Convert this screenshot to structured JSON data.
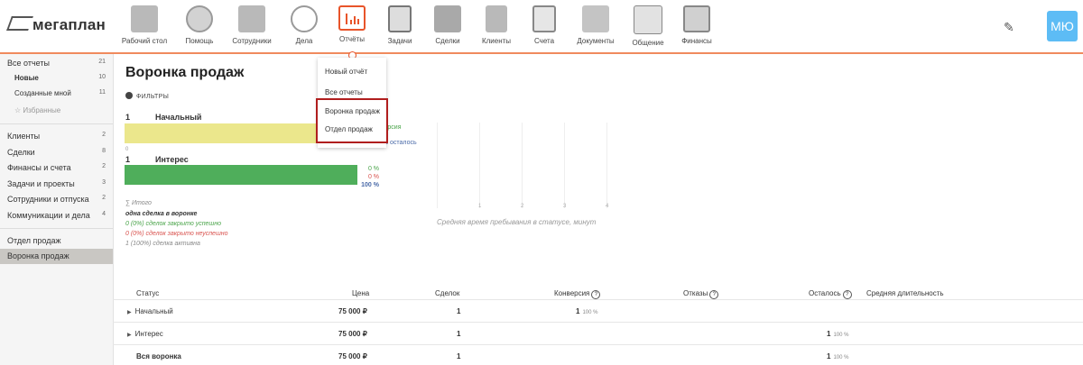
{
  "app": {
    "logo": "мегаплан",
    "avatar_initials": "МЮ"
  },
  "nav": [
    {
      "label": "Рабочий стол",
      "icon": "desktop-icon"
    },
    {
      "label": "Помощь",
      "icon": "lifebuoy-icon"
    },
    {
      "label": "Сотрудники",
      "icon": "employees-icon"
    },
    {
      "label": "Дела",
      "icon": "clock-icon"
    },
    {
      "label": "Отчёты",
      "icon": "report-chart-icon",
      "active": true
    },
    {
      "label": "Задачи",
      "icon": "clipboard-check-icon"
    },
    {
      "label": "Сделки",
      "icon": "briefcase-icon"
    },
    {
      "label": "Клиенты",
      "icon": "client-card-icon"
    },
    {
      "label": "Счета",
      "icon": "invoice-icon"
    },
    {
      "label": "Документы",
      "icon": "folder-icon"
    },
    {
      "label": "Общение",
      "icon": "chat-bubbles-icon"
    },
    {
      "label": "Финансы",
      "icon": "safe-icon"
    }
  ],
  "sidebar": {
    "all_reports": {
      "label": "Все отчеты",
      "count": "21"
    },
    "new": {
      "label": "Новые",
      "count": "10"
    },
    "mine": {
      "label": "Созданные мной",
      "count": "11"
    },
    "favorites": {
      "label": "Избранные"
    },
    "groups": [
      {
        "label": "Клиенты",
        "count": "2"
      },
      {
        "label": "Сделки",
        "count": "8"
      },
      {
        "label": "Финансы и счета",
        "count": "2"
      },
      {
        "label": "Задачи и проекты",
        "count": "3"
      },
      {
        "label": "Сотрудники и отпуска",
        "count": "2"
      },
      {
        "label": "Коммуникации и дела",
        "count": "4"
      }
    ],
    "reports": [
      {
        "label": "Отдел продаж"
      },
      {
        "label": "Воронка продаж",
        "active": true
      }
    ]
  },
  "dropdown": {
    "items": [
      "Новый отчёт",
      "Все отчеты",
      "Воронка продаж",
      "Отдел продаж"
    ]
  },
  "page": {
    "title": "Воронка продаж",
    "filters": "ФИЛЬТРЫ"
  },
  "funnel": {
    "stages": [
      {
        "count": "1",
        "name": "Начальный",
        "pct1": "",
        "pct2": "",
        "pct3": ""
      },
      {
        "count": "1",
        "name": "Интерес",
        "pct1": "0 %",
        "pct2": "0 %",
        "pct3": "100 %"
      }
    ],
    "colors": {
      "stage1": "#ebe78c",
      "stage2": "#4fae5b",
      "green": "#4aa44a",
      "red": "#d9534f",
      "blue": "#4a6aa8"
    },
    "conversion_partial": "нверсия",
    "loss_partial": "аз",
    "remaining_partial": "0 % осталось",
    "summary": {
      "total": "Итого",
      "one_deal": "одна сделка в воронке",
      "won": "0 (0%) сделок закрыто успешно",
      "lost": "0 (0%) сделок закрыто неуспешно",
      "active": "1 (100%) сделка активна"
    },
    "stage2_arrow": "0"
  },
  "chart_data": {
    "type": "bar",
    "orientation": "horizontal",
    "title": "",
    "xlabel": "Средняя время пребывания в статусе, минут",
    "ylabel": "",
    "categories": [],
    "values": [],
    "x_ticks": [
      "1",
      "2",
      "3",
      "4"
    ],
    "grid": true
  },
  "table": {
    "headers": {
      "status": "Статус",
      "price": "Цена",
      "deals": "Сделок",
      "conversion": "Конверсия",
      "losses": "Отказы",
      "remaining": "Осталось",
      "avg_duration": "Средняя длительность"
    },
    "rows": [
      {
        "status": "Начальный",
        "price": "75 000 ₽",
        "deals": "1",
        "conversion": "1",
        "conversion_pct": "100 %",
        "remaining": "",
        "remaining_pct": ""
      },
      {
        "status": "Интерес",
        "price": "75 000 ₽",
        "deals": "1",
        "conversion": "",
        "conversion_pct": "",
        "remaining": "1",
        "remaining_pct": "100 %"
      },
      {
        "status": "Вся воронка",
        "price": "75 000 ₽",
        "deals": "1",
        "conversion": "",
        "conversion_pct": "",
        "remaining": "1",
        "remaining_pct": "100 %"
      }
    ]
  }
}
